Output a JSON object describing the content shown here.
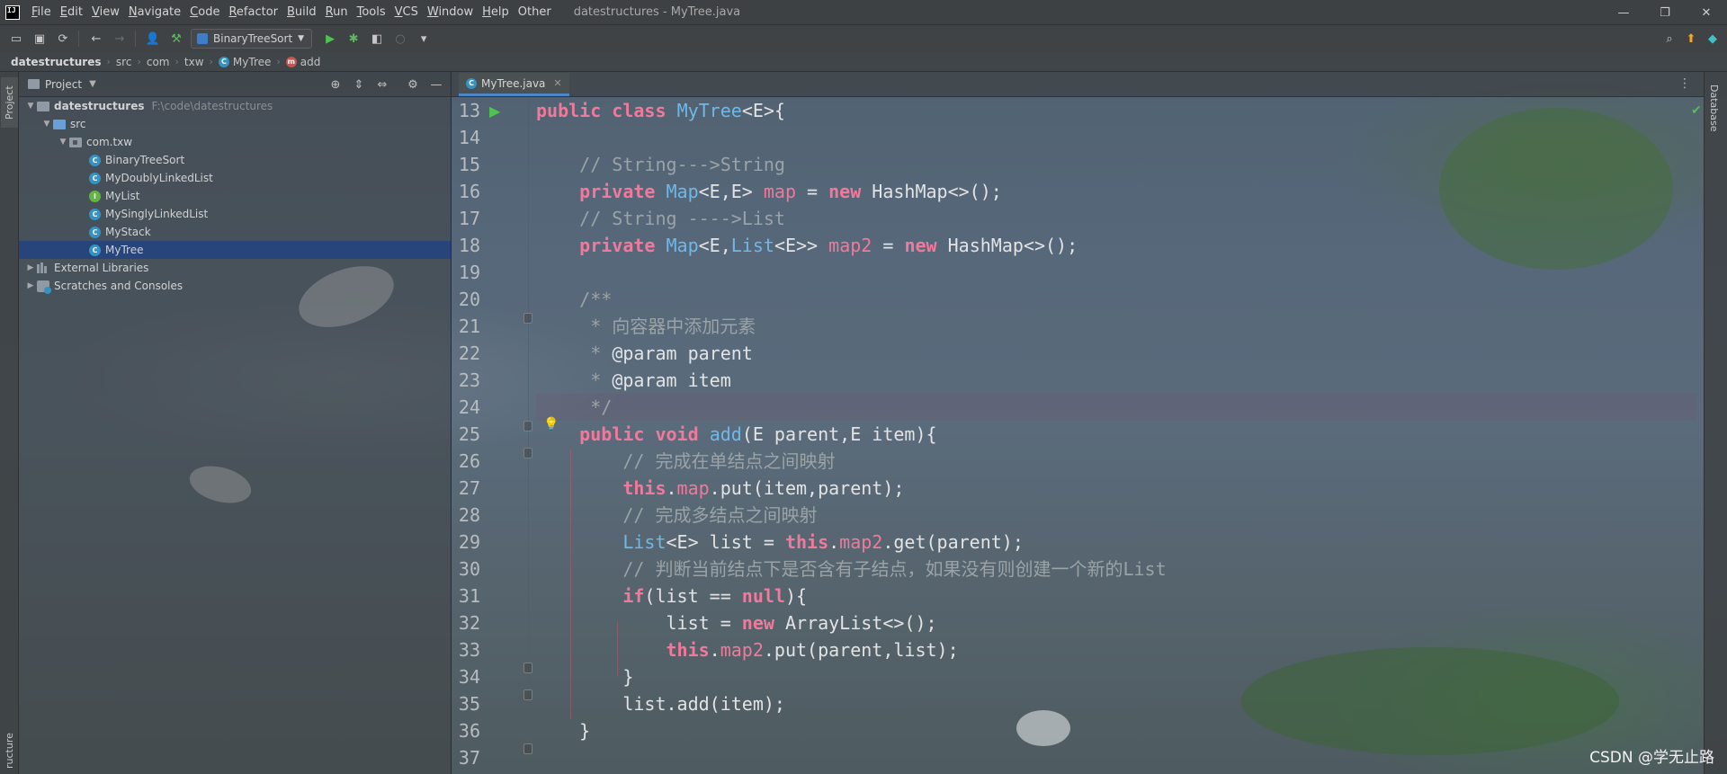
{
  "menubar": {
    "logo": "IJ",
    "items": [
      {
        "label": "File",
        "ul": "F",
        "rest": "ile"
      },
      {
        "label": "Edit",
        "ul": "E",
        "rest": "dit"
      },
      {
        "label": "View",
        "ul": "V",
        "rest": "iew"
      },
      {
        "label": "Navigate",
        "ul": "N",
        "rest": "avigate"
      },
      {
        "label": "Code",
        "ul": "C",
        "rest": "ode"
      },
      {
        "label": "Refactor",
        "ul": "R",
        "rest": "efactor"
      },
      {
        "label": "Build",
        "ul": "B",
        "rest": "uild"
      },
      {
        "label": "Run",
        "ul": "R",
        "rest": "un"
      },
      {
        "label": "Tools",
        "ul": "T",
        "rest": "ools"
      },
      {
        "label": "VCS",
        "ul": "V",
        "rest": "CS"
      },
      {
        "label": "Window",
        "ul": "W",
        "rest": "indow"
      },
      {
        "label": "Help",
        "ul": "H",
        "rest": "elp"
      },
      {
        "label": "Other",
        "ul": "",
        "rest": "Other"
      }
    ],
    "window_title": "datestructures - MyTree.java",
    "minimize": "—",
    "maximize": "❐",
    "close": "✕"
  },
  "toolbar": {
    "run_config": "BinaryTreeSort",
    "run_config_caret": "▼"
  },
  "breadcrumb": [
    "datestructures",
    "src",
    "com",
    "txw",
    "MyTree",
    "add"
  ],
  "left_stripe": {
    "project_tab": "Project",
    "structure_tab": "ructure"
  },
  "project": {
    "title": "Project",
    "root_name": "datestructures",
    "root_path": "F:\\code\\datestructures",
    "src": "src",
    "package": "com.txw",
    "classes": [
      {
        "name": "BinaryTreeSort",
        "kind": "class"
      },
      {
        "name": "MyDoublyLinkedList",
        "kind": "class"
      },
      {
        "name": "MyList",
        "kind": "interface"
      },
      {
        "name": "MySinglyLinkedList",
        "kind": "class"
      },
      {
        "name": "MyStack",
        "kind": "class"
      },
      {
        "name": "MyTree",
        "kind": "class",
        "selected": true
      }
    ],
    "external_libraries": "External Libraries",
    "scratches": "Scratches and Consoles"
  },
  "editor": {
    "tab_label": "MyTree.java",
    "line_numbers": [
      "13",
      "14",
      "15",
      "16",
      "17",
      "18",
      "19",
      "20",
      "21",
      "22",
      "23",
      "24",
      "25",
      "26",
      "27",
      "28",
      "29",
      "30",
      "31",
      "32",
      "33",
      "34",
      "35",
      "36",
      "37"
    ]
  },
  "right_stripe": {
    "database_tab": "Database"
  },
  "watermark": "CSDN @学无止路",
  "colors": {
    "keyword": "#ef7a9b",
    "type": "#6fb8e8",
    "comment": "#9aa3a6",
    "selection": "#214283",
    "tab_underline": "#4a88c7"
  }
}
